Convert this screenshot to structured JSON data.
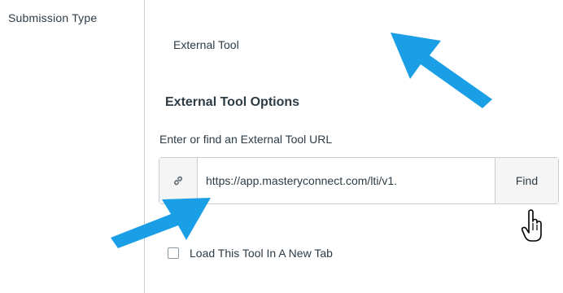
{
  "form": {
    "submission_type_label": "Submission Type",
    "submission_type_value": "External Tool",
    "select_arrow": "▾",
    "section_title": "External Tool Options",
    "url_label": "Enter or find an External Tool URL",
    "url_value": "https://app.masteryconnect.com/lti/v1.",
    "find_label": "Find",
    "new_tab_label": "Load This Tool In A New Tab"
  },
  "icons": {
    "link": "link-icon",
    "cursor": "hand-pointer-icon",
    "arrows": "callout-arrow"
  },
  "colors": {
    "annotation_arrow": "#1a9fe6",
    "text": "#2d3b45",
    "border": "#c7cdd1"
  }
}
